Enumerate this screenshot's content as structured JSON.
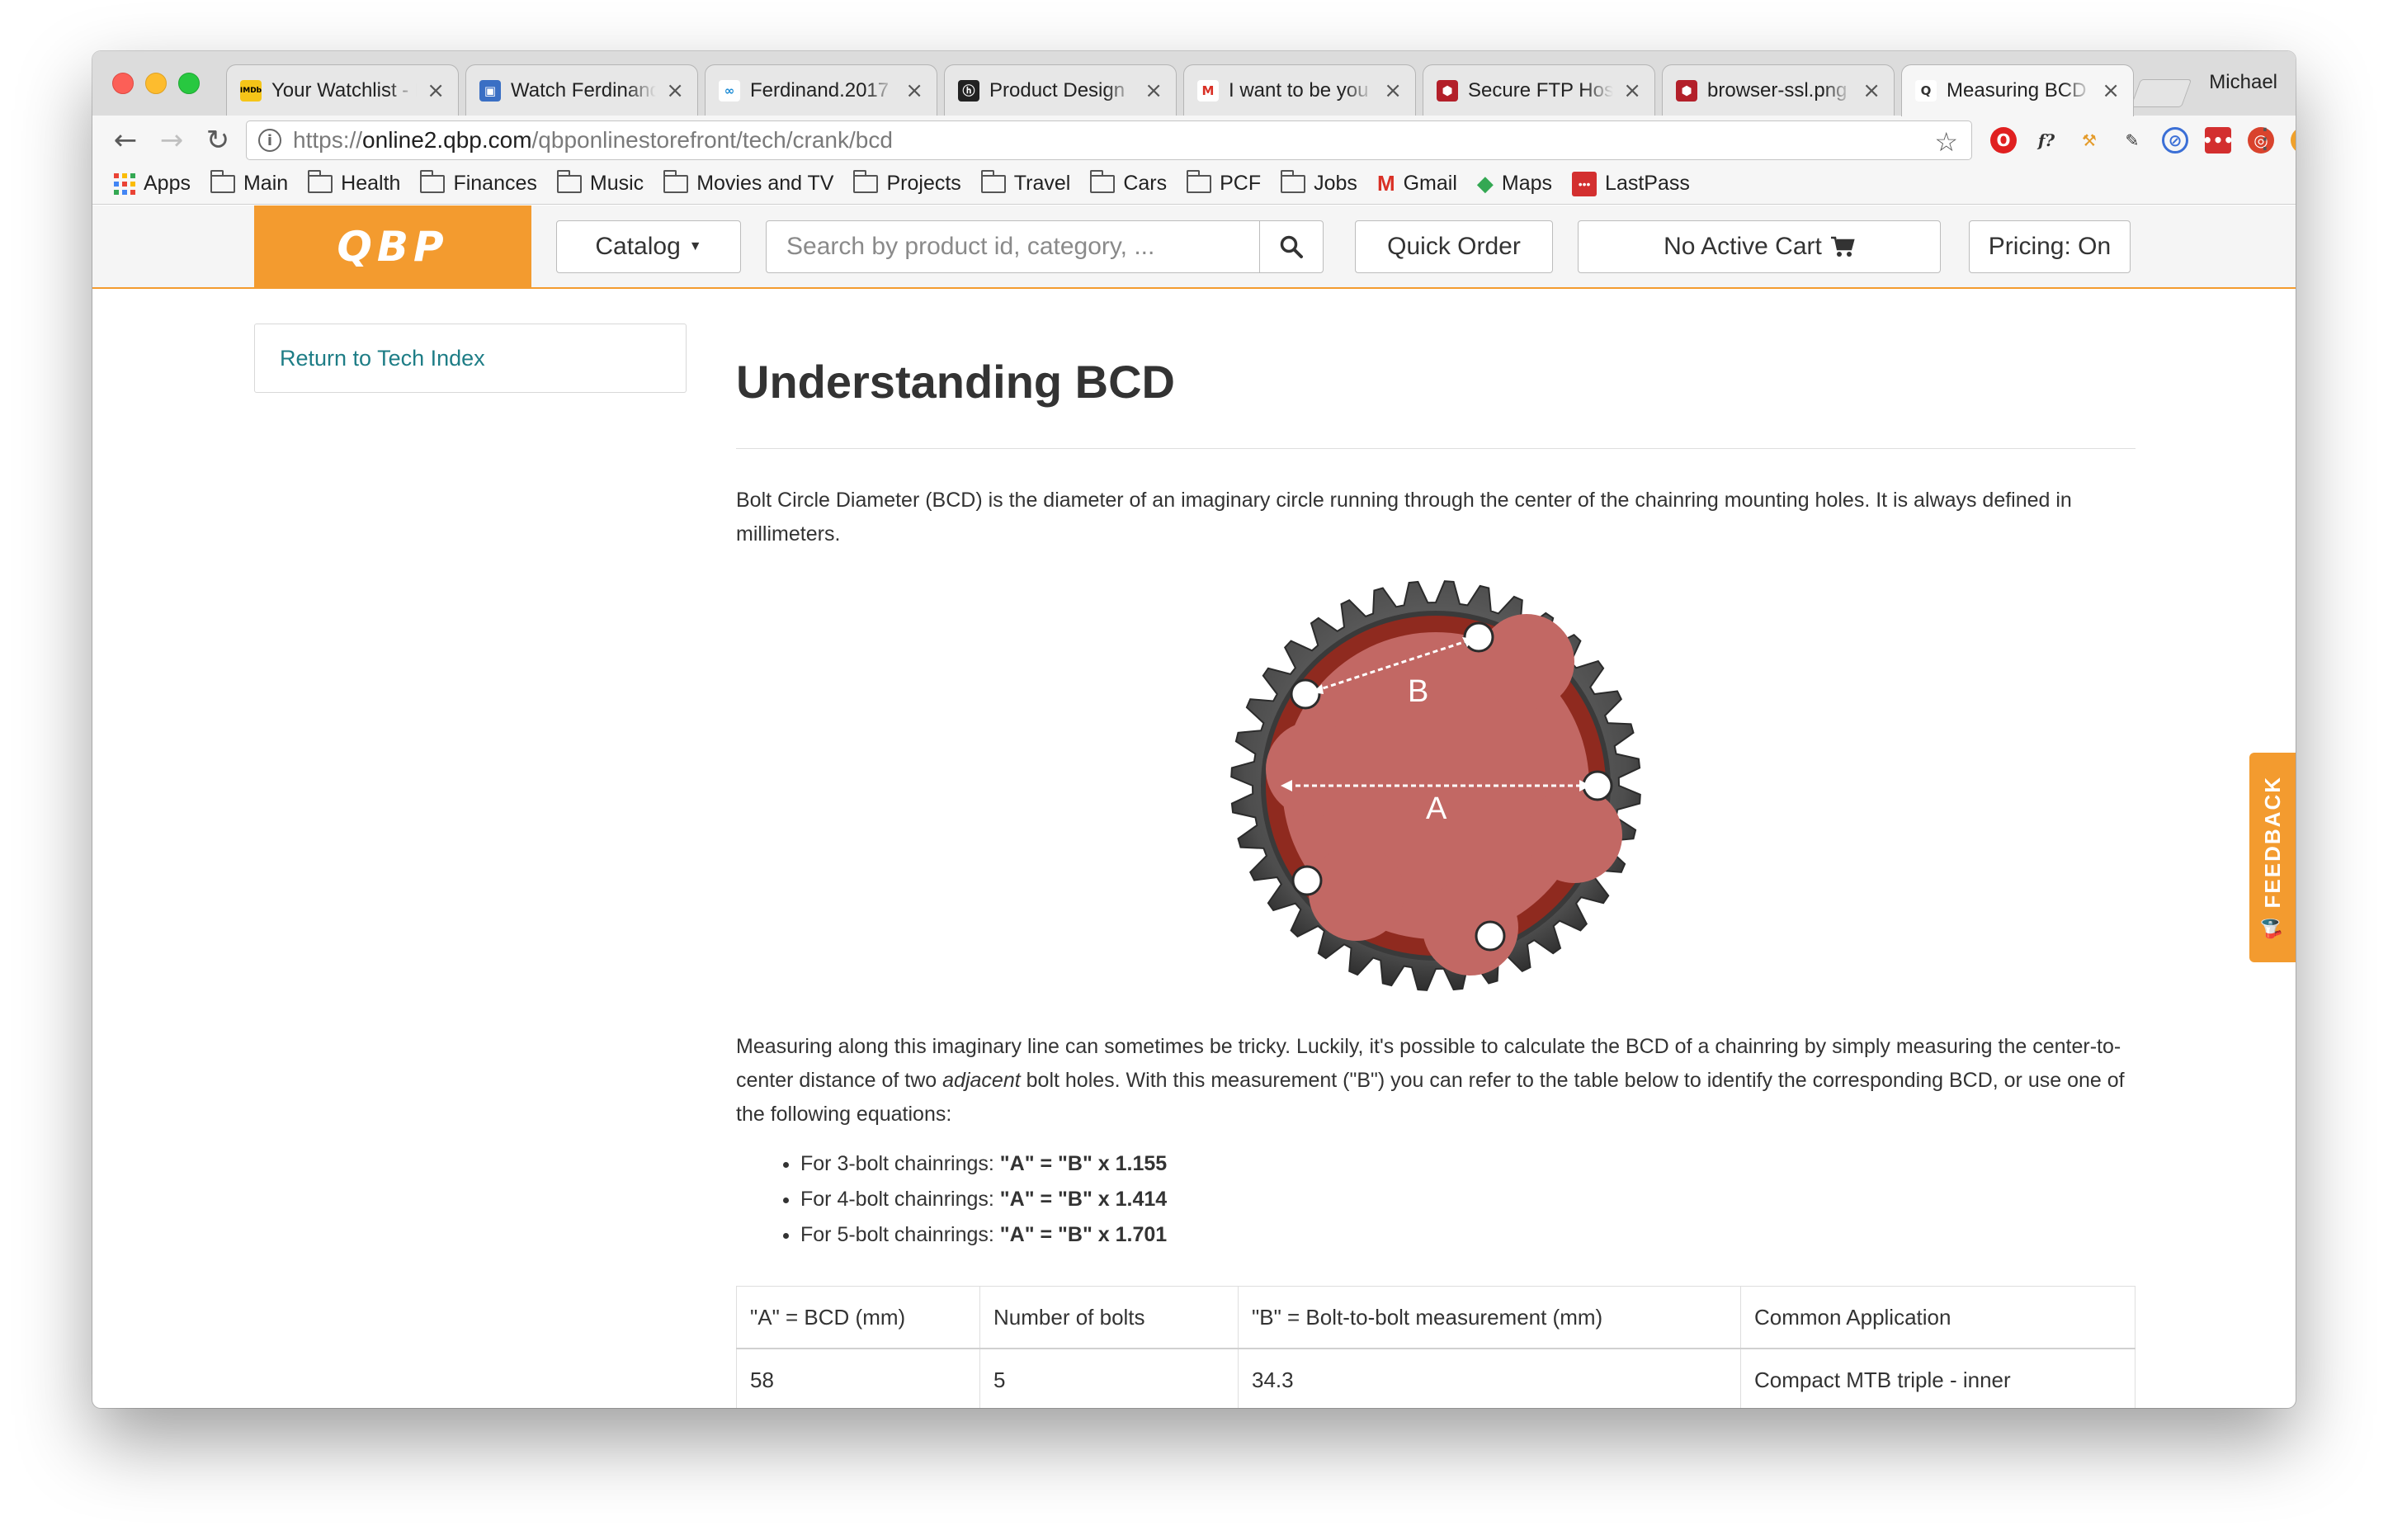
{
  "browser": {
    "tabs": [
      {
        "title": "Your Watchlist - IMDb",
        "favicon_text": "IMDb",
        "favicon_color": "#f5c518",
        "favicon_text_color": "#000000"
      },
      {
        "title": "Watch Ferdinand",
        "favicon_text": "▣",
        "favicon_color": "#3a6fc4",
        "favicon_text_color": "#ffffff"
      },
      {
        "title": "Ferdinand.2017",
        "favicon_text": "∞",
        "favicon_color": "#ffffff",
        "favicon_text_color": "#1a8ad4"
      },
      {
        "title": "Product Design",
        "favicon_text": "ⓗ",
        "favicon_color": "#222222",
        "favicon_text_color": "#ffffff"
      },
      {
        "title": "I want to be you",
        "favicon_text": "M",
        "favicon_color": "#ffffff",
        "favicon_text_color": "#d93025"
      },
      {
        "title": "Secure FTP Hos",
        "favicon_text": "⬢",
        "favicon_color": "#b3202a",
        "favicon_text_color": "#ffffff"
      },
      {
        "title": "browser-ssl.png",
        "favicon_text": "⬢",
        "favicon_color": "#b3202a",
        "favicon_text_color": "#ffffff"
      },
      {
        "title": "Measuring BCD",
        "favicon_text": "Q",
        "favicon_color": "#ffffff",
        "favicon_text_color": "#333333",
        "active": true
      }
    ],
    "close_glyph": "×",
    "profile_name": "Michael",
    "url": {
      "scheme": "https://",
      "host": "online2.qbp.com",
      "path": "/qbponlinestorefront/tech/crank/bcd"
    },
    "bookmarks": [
      {
        "label": "Apps",
        "type": "apps"
      },
      {
        "label": "Main",
        "type": "folder"
      },
      {
        "label": "Health",
        "type": "folder"
      },
      {
        "label": "Finances",
        "type": "folder"
      },
      {
        "label": "Music",
        "type": "folder"
      },
      {
        "label": "Movies and TV",
        "type": "folder"
      },
      {
        "label": "Projects",
        "type": "folder"
      },
      {
        "label": "Travel",
        "type": "folder"
      },
      {
        "label": "Cars",
        "type": "folder"
      },
      {
        "label": "PCF",
        "type": "folder"
      },
      {
        "label": "Jobs",
        "type": "folder"
      },
      {
        "label": "Gmail",
        "type": "gmail"
      },
      {
        "label": "Maps",
        "type": "maps"
      },
      {
        "label": "LastPass",
        "type": "lastpass"
      }
    ]
  },
  "site": {
    "logo": "QBP",
    "catalog_label": "Catalog",
    "search_placeholder": "Search by product id, category, ...",
    "quick_order_label": "Quick Order",
    "cart_label": "No Active Cart",
    "pricing_label": "Pricing: On",
    "accent_color": "#f39b2f",
    "link_color": "#1e7d86"
  },
  "sidebar": {
    "return_link": "Return to Tech Index"
  },
  "article": {
    "title": "Understanding BCD",
    "intro": "Bolt Circle Diameter (BCD) is the diameter of an imaginary circle running through the center of the chainring mounting holes. It is always defined in millimeters.",
    "diagram": {
      "label_a": "A",
      "label_b": "B"
    },
    "measure_part1": "Measuring along this imaginary line can sometimes be tricky. Luckily, it's possible to calculate the BCD of a chainring by simply measuring the center-to-center distance of two",
    "measure_emphasis": "adjacent",
    "measure_part2": "bolt holes. With this measurement (\"B\") you can refer to the table below to identify the corresponding BCD, or use one of the following equations:",
    "equations": [
      {
        "prefix": "For 3-bolt chainrings:",
        "formula": "\"A\" = \"B\" x 1.155"
      },
      {
        "prefix": "For 4-bolt chainrings:",
        "formula": "\"A\" = \"B\" x 1.414"
      },
      {
        "prefix": "For 5-bolt chainrings:",
        "formula": "\"A\" = \"B\" x 1.701"
      }
    ],
    "table": {
      "headers": [
        "\"A\" = BCD (mm)",
        "Number of bolts",
        "\"B\" = Bolt-to-bolt measurement (mm)",
        "Common Application"
      ],
      "rows": [
        [
          "58",
          "5",
          "34.3",
          "Compact MTB triple - inner"
        ]
      ]
    }
  },
  "feedback_label": "FEEDBACK"
}
